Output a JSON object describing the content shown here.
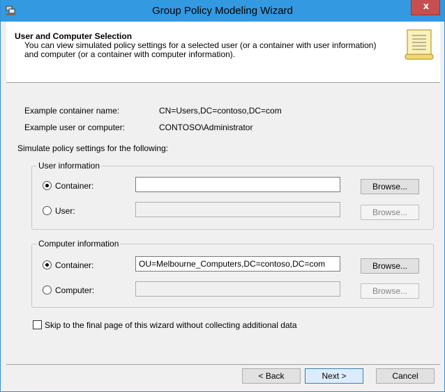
{
  "window": {
    "title": "Group Policy Modeling Wizard",
    "close_label": "x"
  },
  "header": {
    "title": "User and Computer Selection",
    "description": "You can view simulated policy settings for a selected user (or a container with user information) and computer (or a container with computer information)."
  },
  "examples": {
    "container_label": "Example container name:",
    "container_value": "CN=Users,DC=contoso,DC=com",
    "user_label": "Example user or computer:",
    "user_value": "CONTOSO\\Administrator"
  },
  "simulate_label": "Simulate policy settings for the following:",
  "user_info": {
    "group_label": "User information",
    "container_label": "Container:",
    "container_value": "",
    "container_selected": true,
    "user_label": "User:",
    "user_value": "",
    "user_selected": false,
    "browse_label": "Browse..."
  },
  "computer_info": {
    "group_label": "Computer information",
    "container_label": "Container:",
    "container_value": "OU=Melbourne_Computers,DC=contoso,DC=com",
    "container_selected": true,
    "computer_label": "Computer:",
    "computer_value": "",
    "computer_selected": false,
    "browse_label": "Browse..."
  },
  "skip_checkbox": {
    "label": "Skip to the final page of this wizard without collecting additional data",
    "checked": false
  },
  "buttons": {
    "back": "< Back",
    "next": "Next >",
    "cancel": "Cancel"
  },
  "colors": {
    "titlebar": "#3399e0",
    "close": "#c74f4f"
  }
}
